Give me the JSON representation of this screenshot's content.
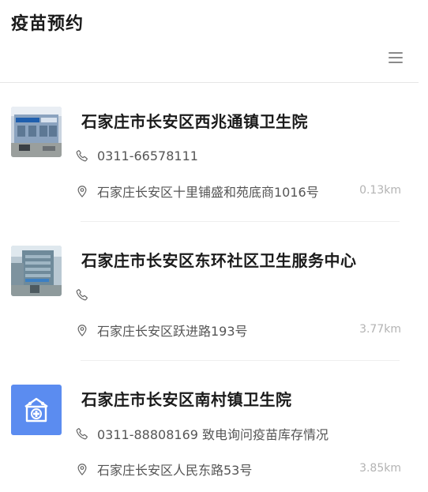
{
  "header": {
    "title": "疫苗预约",
    "menu_icon": "hamburger-menu-icon"
  },
  "icons": {
    "phone": "phone-icon",
    "location": "location-pin-icon"
  },
  "colors": {
    "accent_blue": "#5b8cf0",
    "distance_gray": "#b3b3b3"
  },
  "clinics": [
    {
      "name": "石家庄市长安区西兆通镇卫生院",
      "phone": "0311-66578111",
      "address": "石家庄长安区十里铺盛和苑底商1016号",
      "distance": "0.13km"
    },
    {
      "name": "石家庄市长安区东环社区卫生服务中心",
      "phone": "",
      "address": "石家庄长安区跃进路193号",
      "distance": "3.77km"
    },
    {
      "name": "石家庄市长安区南村镇卫生院",
      "phone": "0311-88808169 致电询问疫苗库存情况",
      "address": "石家庄长安区人民东路53号",
      "distance": "3.85km"
    }
  ]
}
